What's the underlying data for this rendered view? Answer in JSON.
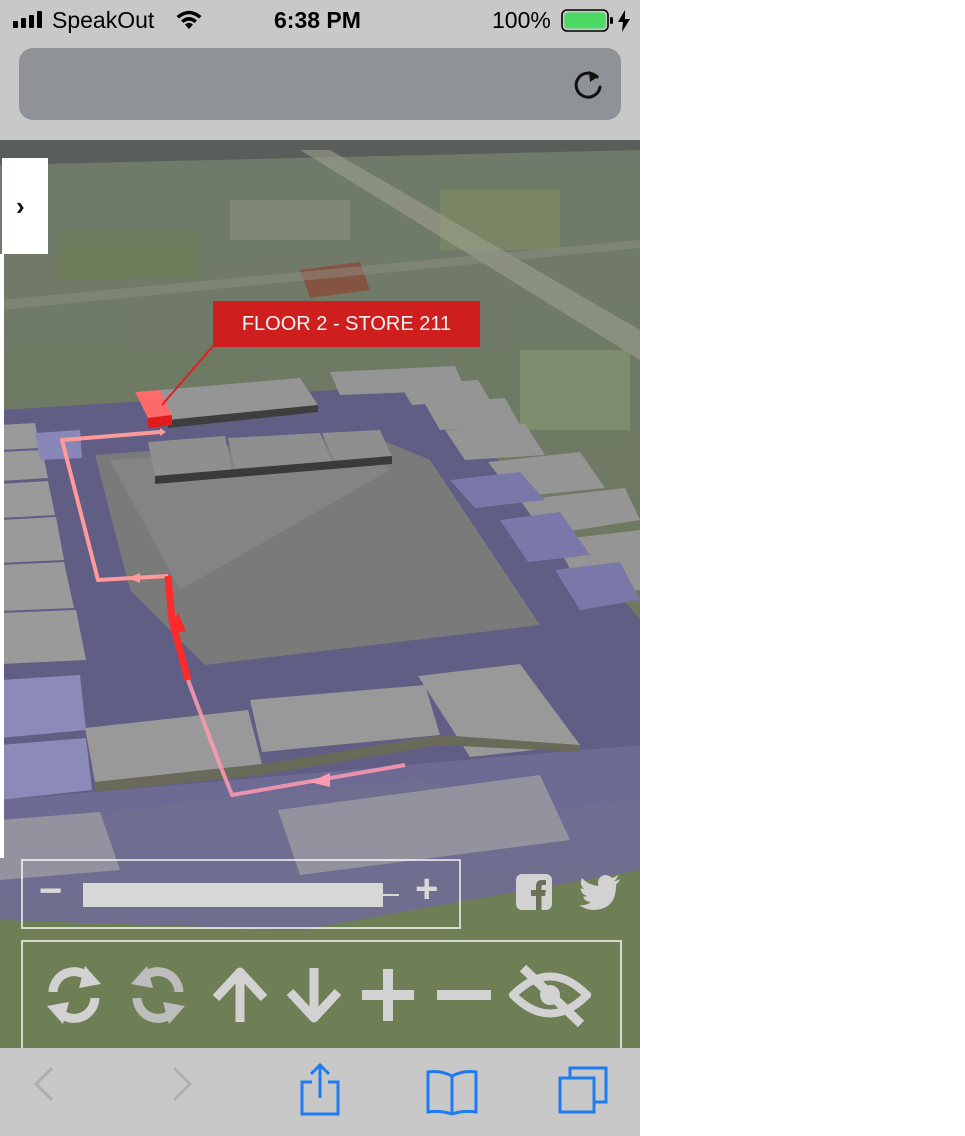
{
  "status_bar": {
    "carrier": "SpeakOut",
    "time": "6:38 PM",
    "battery_percent": "100%",
    "battery_level": 1.0,
    "charging": true,
    "signal_bars": 4,
    "icons": [
      "signal-icon",
      "wifi-icon",
      "battery-icon",
      "charging-bolt-icon"
    ]
  },
  "browser": {
    "url": "",
    "icons": [
      "reload-icon"
    ]
  },
  "map": {
    "callout_label": "FLOOR 2 - STORE 211",
    "side_toggle_icon": "chevron-right-icon",
    "route_color": "#ff2a2a",
    "highlight_color": "#ff3b3b"
  },
  "zoom": {
    "minus_label": "−",
    "plus_label": "+",
    "level": 1.0
  },
  "social": [
    "facebook-icon",
    "twitter-icon"
  ],
  "controls": [
    "rotate-clockwise-icon",
    "rotate-counterclockwise-icon",
    "arrow-up-icon",
    "arrow-down-icon",
    "plus-icon",
    "minus-icon",
    "eye-slash-icon"
  ],
  "toolbar": [
    "back-icon",
    "forward-icon",
    "share-icon",
    "bookmarks-icon",
    "tabs-icon"
  ],
  "colors": {
    "chrome_gray": "#c8c8c8",
    "url_field": "#8f9296",
    "ios_blue": "#1e7cf0",
    "control_gray": "#d2d2d2",
    "callout_red": "#d61818",
    "mall_floor": "#5d5b80"
  }
}
